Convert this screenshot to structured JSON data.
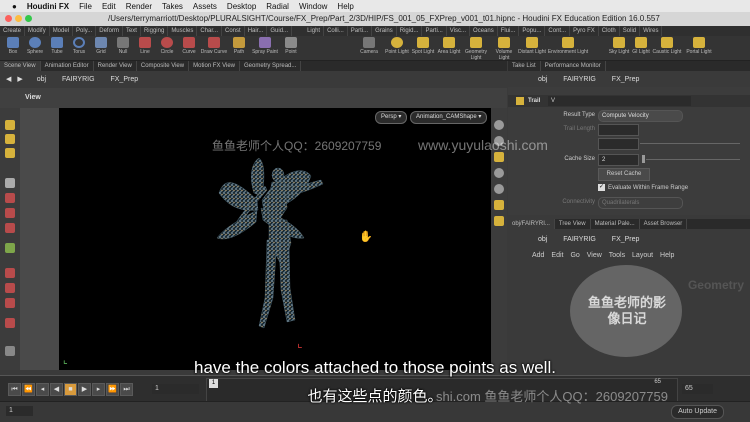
{
  "menubar": {
    "app": "Houdini FX",
    "items": [
      "File",
      "Edit",
      "Render",
      "Takes",
      "Assets",
      "Desktop",
      "Radial",
      "Window",
      "Help"
    ]
  },
  "window_title": "/Users/terrymarriott/Desktop/PLURALSIGHT/Course/FX_Prep/Part_2/3D/HIP/FS_001_05_FXPrep_v001_t01.hipnc - Houdini FX Education Edition 16.0.557",
  "shelf_tabs_left": [
    "Create",
    "Modify",
    "Model",
    "Poly...",
    "Deform",
    "Text",
    "Rigging",
    "Muscles",
    "Char...",
    "Const",
    "Hair...",
    "Guid..."
  ],
  "shelf_tabs_right": [
    "Light",
    "Colli...",
    "Parti...",
    "Grains",
    "Rigid...",
    "Parti...",
    "Visc...",
    "Oceans",
    "Flui...",
    "Popu...",
    "Cont...",
    "Pyro FX",
    "Cloth",
    "Solid",
    "Wires"
  ],
  "tools_left": [
    "Box",
    "Sphere",
    "Tube",
    "Torus",
    "Grid",
    "Null",
    "Line",
    "Circle",
    "Curve",
    "Draw Curve",
    "Path",
    "Spray Paint",
    "Point"
  ],
  "tools_right": [
    "Camera",
    "Point Light",
    "Spot Light",
    "Area Light",
    "Geometry Light",
    "Volume Light",
    "Distant Light",
    "Environment Light",
    "Sky Light",
    "GI Light",
    "Caustic Light",
    "Portal Light"
  ],
  "left_pane_tabs": [
    "Scene View",
    "Animation Editor",
    "Render View",
    "Composite View",
    "Motion FX View",
    "Geometry Spread..."
  ],
  "left_path": [
    "obj",
    "FAIRYRIG",
    "FX_Prep"
  ],
  "view_label": "View",
  "camera_dropdown": "Persp",
  "anim_dropdown": "Animation_CAMShape",
  "right_top_tabs": [
    "Take List",
    "Performance Monitor"
  ],
  "right_path": [
    "obj",
    "FAIRYRIG",
    "FX_Prep"
  ],
  "node_name": "Trail",
  "node_value": "V",
  "params": {
    "result_type_label": "Result Type",
    "result_type_value": "Compute Velocity",
    "trail_length_label": "Trail Length",
    "cache_size_label": "Cache Size",
    "cache_size_value": "2",
    "reset_cache": "Reset Cache",
    "evaluate_label": "Evaluate Within Frame Range",
    "connectivity_label": "Connectivity",
    "connectivity_value": "Quadrilaterals"
  },
  "net_tabs": [
    "obj/FAIRYRI...",
    "Tree View",
    "Material Pale...",
    "Asset Browser"
  ],
  "net_path": [
    "obj",
    "FAIRYRIG",
    "FX_Prep"
  ],
  "net_menu": [
    "Add",
    "Edit",
    "Go",
    "View",
    "Tools",
    "Layout",
    "Help"
  ],
  "net_label": "Geometry",
  "timeline": {
    "start": "1",
    "current": "1",
    "end": "65",
    "tick_start": "1",
    "tick_end": "65"
  },
  "auto_update": "Auto Update",
  "subtitle_en": "have the colors attached to those points as well.",
  "subtitle_zh": "也有这些点的颜色。",
  "watermark_top": "鱼鱼老师个人QQ：2609207759",
  "watermark_url": "www.yuyulaoshi.com",
  "watermark_bottom": "shi.com  鱼鱼老师个人QQ：2609207759",
  "logo_text": "鱼鱼老师的影像日记"
}
